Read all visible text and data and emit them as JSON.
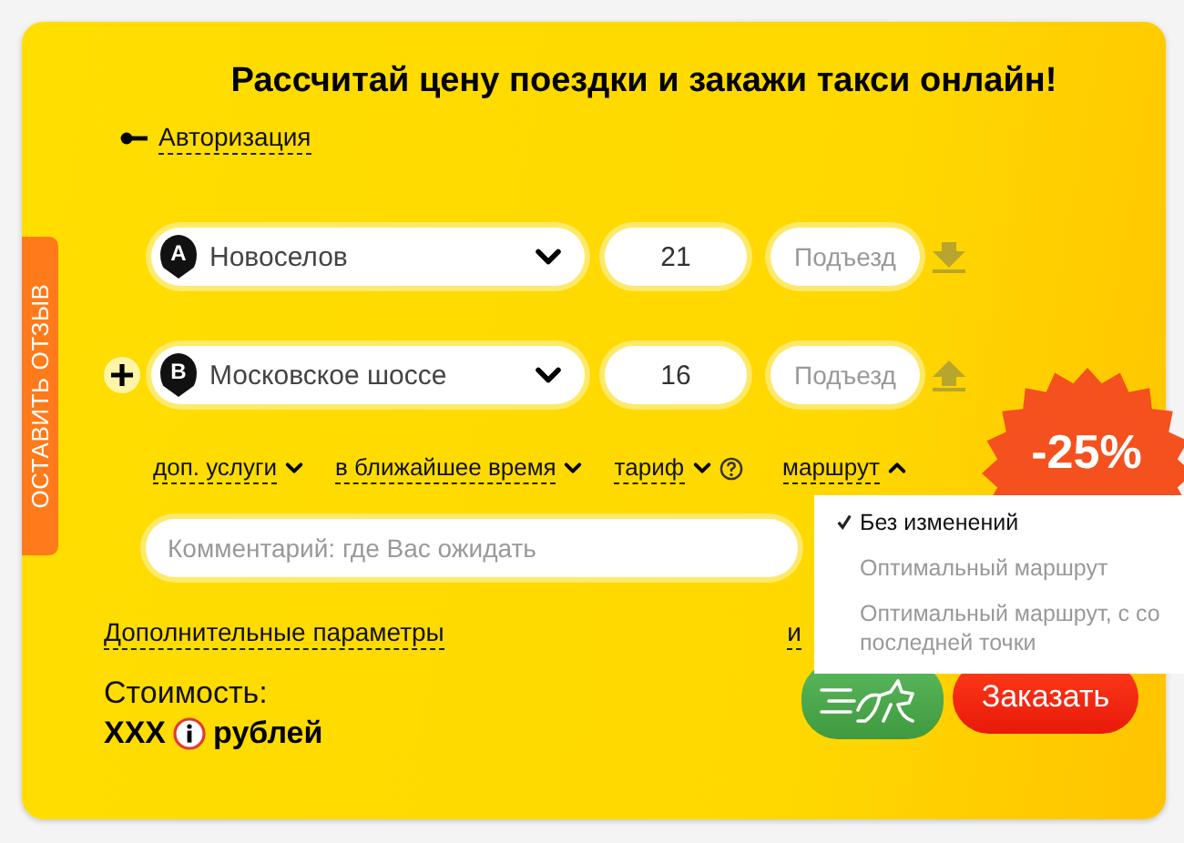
{
  "title": "Рассчитай цену поездки и закажи такси онлайн!",
  "auth_link": "Авторизация",
  "feedback_tab": "ОСТАВИТЬ ОТЗЫВ",
  "points": [
    {
      "marker": "A",
      "address": "Новоселов",
      "house": "21",
      "entrance_placeholder": "Подъезд",
      "can_add": false,
      "kind": "start"
    },
    {
      "marker": "B",
      "address": "Московское шоссе",
      "house": "16",
      "entrance_placeholder": "Подъезд",
      "can_add": true,
      "kind": "end"
    }
  ],
  "options": [
    {
      "label": "доп. услуги",
      "expanded": false,
      "help": false
    },
    {
      "label": "в ближайшее время",
      "expanded": false,
      "help": false
    },
    {
      "label": "тариф",
      "expanded": false,
      "help": true
    },
    {
      "label": "маршрут",
      "expanded": true,
      "help": false
    }
  ],
  "comment_placeholder": "Комментарий: где Вас ожидать",
  "more_link": "Дополнительные параметры",
  "partial_link": "и",
  "cost": {
    "label": "Стоимость:",
    "amount": "XXX",
    "currency": "рублей"
  },
  "route_menu": [
    {
      "label": "Без изменений",
      "selected": true
    },
    {
      "label": "Оптимальный маршрут",
      "selected": false
    },
    {
      "label": "Оптимальный маршрут, с со\nпоследней точки",
      "selected": false
    }
  ],
  "discount": "-25%",
  "order_button": "Заказать"
}
